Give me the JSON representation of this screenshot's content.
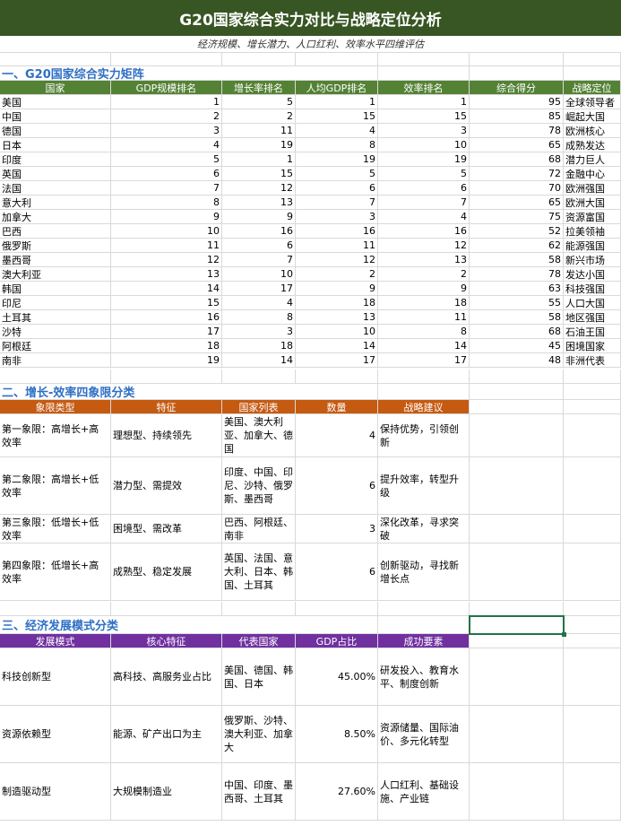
{
  "title": "G20国家综合实力对比与战略定位分析",
  "subtitle": "经济规模、增长潜力、人口红利、效率水平四维评估",
  "section1": {
    "heading": "一、G20国家综合实力矩阵",
    "headers": [
      "国家",
      "GDP规模排名",
      "增长率排名",
      "人均GDP排名",
      "效率排名",
      "综合得分",
      "战略定位"
    ],
    "rows": [
      [
        "美国",
        "1",
        "5",
        "1",
        "1",
        "95",
        "全球领导者"
      ],
      [
        "中国",
        "2",
        "2",
        "15",
        "15",
        "85",
        "崛起大国"
      ],
      [
        "德国",
        "3",
        "11",
        "4",
        "3",
        "78",
        "欧洲核心"
      ],
      [
        "日本",
        "4",
        "19",
        "8",
        "10",
        "65",
        "成熟发达"
      ],
      [
        "印度",
        "5",
        "1",
        "19",
        "19",
        "68",
        "潜力巨人"
      ],
      [
        "英国",
        "6",
        "15",
        "5",
        "5",
        "72",
        "金融中心"
      ],
      [
        "法国",
        "7",
        "12",
        "6",
        "6",
        "70",
        "欧洲强国"
      ],
      [
        "意大利",
        "8",
        "13",
        "7",
        "7",
        "65",
        "欧洲大国"
      ],
      [
        "加拿大",
        "9",
        "9",
        "3",
        "4",
        "75",
        "资源富国"
      ],
      [
        "巴西",
        "10",
        "16",
        "16",
        "16",
        "52",
        "拉美领袖"
      ],
      [
        "俄罗斯",
        "11",
        "6",
        "11",
        "12",
        "62",
        "能源强国"
      ],
      [
        "墨西哥",
        "12",
        "7",
        "12",
        "13",
        "58",
        "新兴市场"
      ],
      [
        "澳大利亚",
        "13",
        "10",
        "2",
        "2",
        "78",
        "发达小国"
      ],
      [
        "韩国",
        "14",
        "17",
        "9",
        "9",
        "63",
        "科技强国"
      ],
      [
        "印尼",
        "15",
        "4",
        "18",
        "18",
        "55",
        "人口大国"
      ],
      [
        "土耳其",
        "16",
        "8",
        "13",
        "11",
        "58",
        "地区强国"
      ],
      [
        "沙特",
        "17",
        "3",
        "10",
        "8",
        "68",
        "石油王国"
      ],
      [
        "阿根廷",
        "18",
        "18",
        "14",
        "14",
        "45",
        "困境国家"
      ],
      [
        "南非",
        "19",
        "14",
        "17",
        "17",
        "48",
        "非洲代表"
      ]
    ]
  },
  "section2": {
    "heading": "二、增长-效率四象限分类",
    "headers": [
      "象限类型",
      "特征",
      "国家列表",
      "数量",
      "战略建议"
    ],
    "rows": [
      [
        "第一象限：高增长+高效率",
        "理想型、持续领先",
        "美国、澳大利亚、加拿大、德国",
        "4",
        "保持优势，引领创新"
      ],
      [
        "第二象限：高增长+低效率",
        "潜力型、需提效",
        "印度、中国、印尼、沙特、俄罗斯、墨西哥",
        "6",
        "提升效率，转型升级"
      ],
      [
        "第三象限：低增长+低效率",
        "困境型、需改革",
        "巴西、阿根廷、南非",
        "3",
        "深化改革，寻求突破"
      ],
      [
        "第四象限：低增长+高效率",
        "成熟型、稳定发展",
        "英国、法国、意大利、日本、韩国、土耳其",
        "6",
        "创新驱动，寻找新增长点"
      ]
    ]
  },
  "section3": {
    "heading": "三、经济发展模式分类",
    "headers": [
      "发展模式",
      "核心特征",
      "代表国家",
      "GDP占比",
      "成功要素"
    ],
    "rows": [
      [
        "科技创新型",
        "高科技、高服务业占比",
        "美国、德国、韩国、日本",
        "45.00%",
        "研发投入、教育水平、制度创新"
      ],
      [
        "资源依赖型",
        "能源、矿产出口为主",
        "俄罗斯、沙特、澳大利亚、加拿大",
        "8.50%",
        "资源储量、国际油价、多元化转型"
      ],
      [
        "制造驱动型",
        "大规模制造业",
        "中国、印度、墨西哥、土耳其",
        "27.60%",
        "人口红利、基础设施、产业链"
      ]
    ]
  }
}
